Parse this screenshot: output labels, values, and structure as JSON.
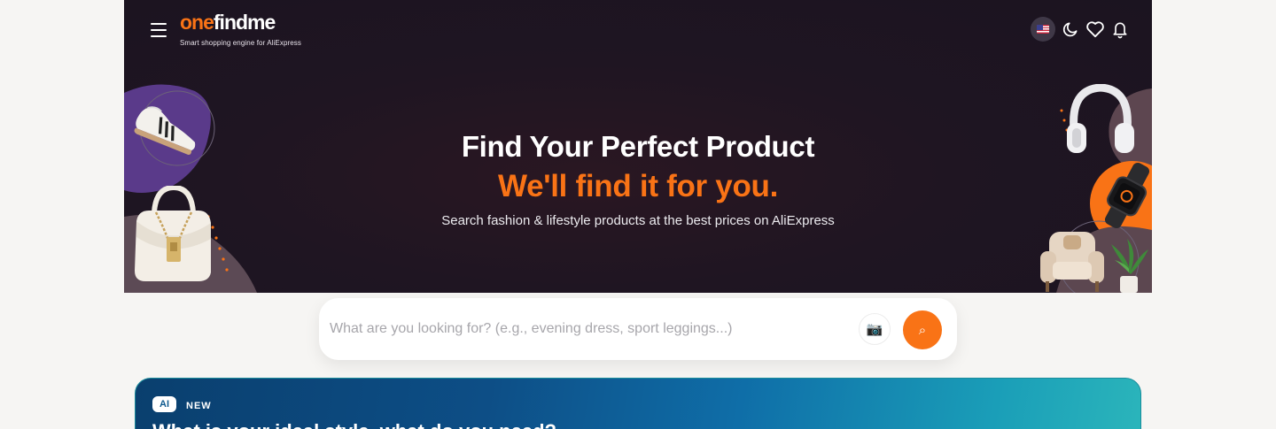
{
  "header": {
    "menu_icon": "hamburger-menu-icon",
    "logo": {
      "part1": "one",
      "part2": "findme",
      "tagline": "Smart shopping engine for AliExpress"
    },
    "icons": [
      "us-flag-icon",
      "moon-icon",
      "heart-icon",
      "bell-icon"
    ]
  },
  "hero": {
    "title": "Find Your Perfect Product",
    "highlight": "We'll find it for you.",
    "subtitle": "Search fashion & lifestyle products at the best prices on AliExpress"
  },
  "search": {
    "placeholder": "What are you looking for? (e.g., evening dress, sport leggings...)",
    "camera_icon": "📷",
    "search_icon": "⌕"
  },
  "ai_card": {
    "badge": "AI",
    "new_label": "NEW",
    "question": "What is your ideal style, what do you need?"
  },
  "colors": {
    "accent": "#f97316",
    "hero_bg": "#1f1522",
    "page_bg": "#f6f5f3",
    "card_gradient_start": "#0a3f6e",
    "card_gradient_end": "#2bb5bb"
  }
}
